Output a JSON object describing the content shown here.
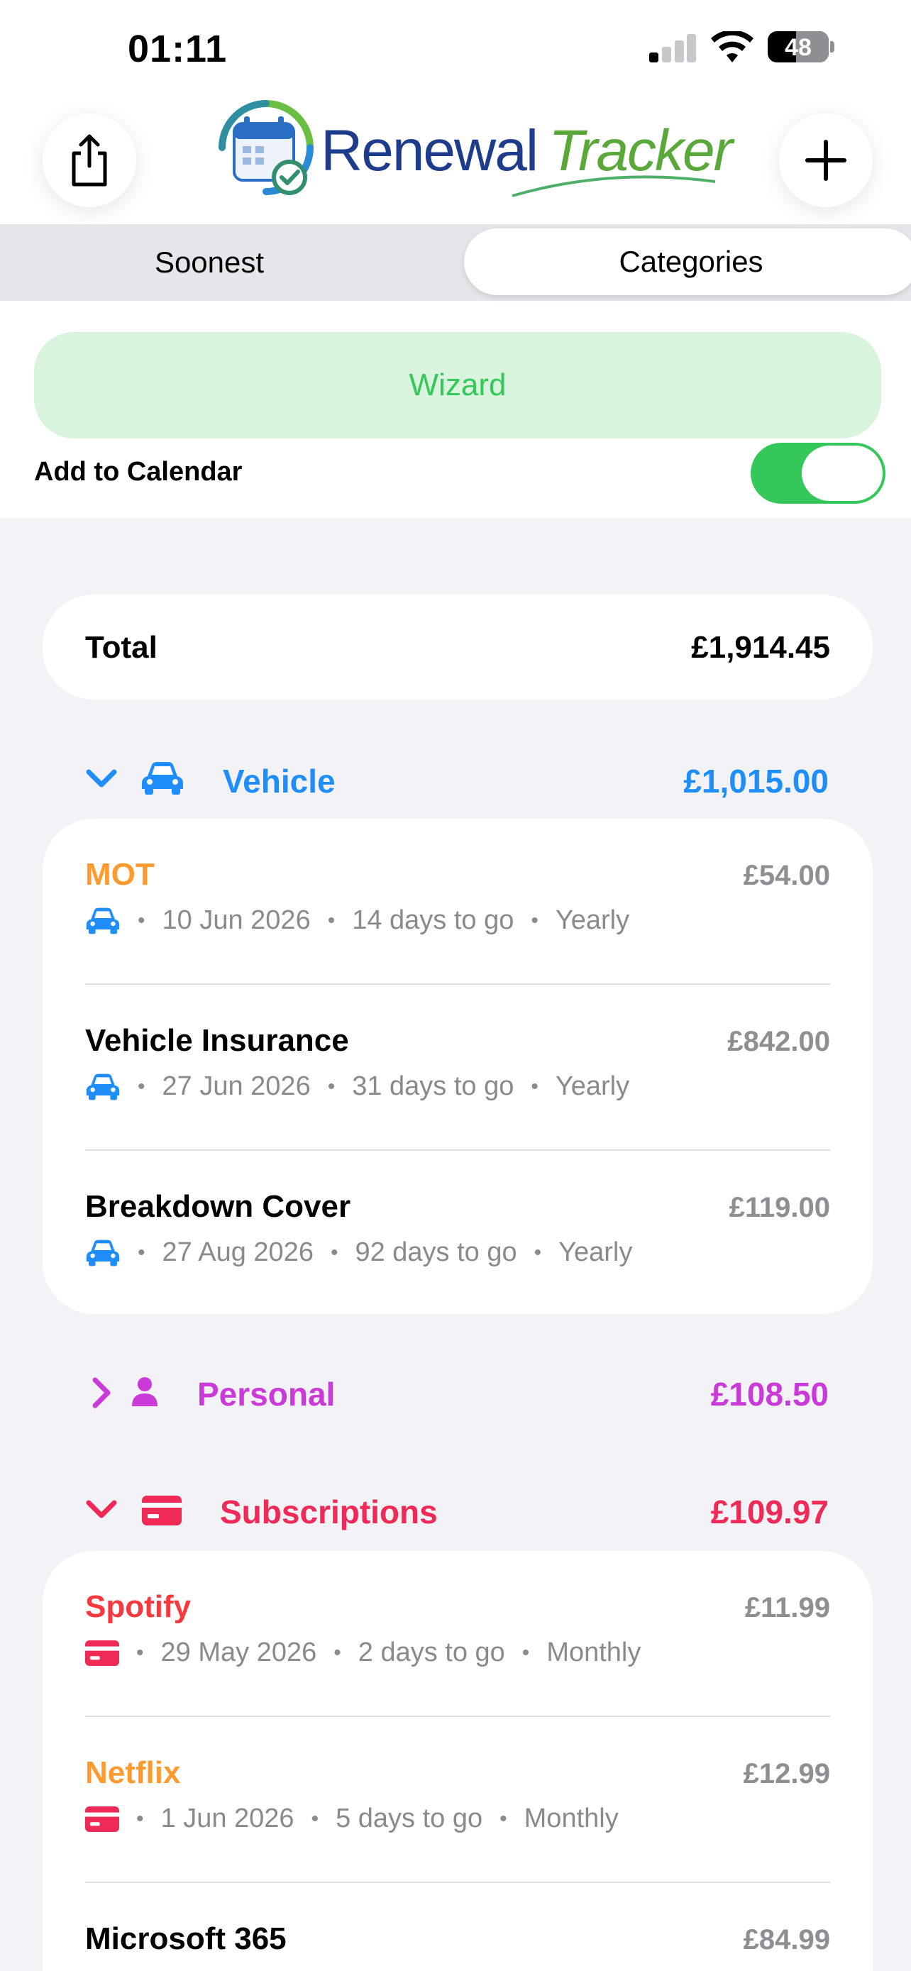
{
  "status_bar": {
    "time": "01:11",
    "battery": "48"
  },
  "header": {
    "logo_word1": "Renewal",
    "logo_word2": "Tracker"
  },
  "tabs": [
    {
      "label": "Soonest",
      "selected": false
    },
    {
      "label": "Categories",
      "selected": true
    }
  ],
  "wizard_label": "Wizard",
  "calendar": {
    "label": "Add to Calendar",
    "enabled": true
  },
  "total": {
    "label": "Total",
    "value": "£1,914.45"
  },
  "categories": [
    {
      "name": "Vehicle",
      "total": "£1,015.00",
      "color": "#1f8efa",
      "expanded": true,
      "icon": "car-icon",
      "items": [
        {
          "name": "MOT",
          "price": "£54.00",
          "date": "10 Jun 2026",
          "due": "14 days to go",
          "freq": "Yearly",
          "name_color": "#ff9a2e"
        },
        {
          "name": "Vehicle Insurance",
          "price": "£842.00",
          "date": "27 Jun 2026",
          "due": "31 days to go",
          "freq": "Yearly",
          "name_color": "#000000"
        },
        {
          "name": "Breakdown Cover",
          "price": "£119.00",
          "date": "27 Aug 2026",
          "due": "92 days to go",
          "freq": "Yearly",
          "name_color": "#000000"
        }
      ]
    },
    {
      "name": "Personal",
      "total": "£108.50",
      "color": "#c93ad8",
      "expanded": false,
      "icon": "person-icon",
      "items": []
    },
    {
      "name": "Subscriptions",
      "total": "£109.97",
      "color": "#ef2a57",
      "expanded": true,
      "icon": "card-icon",
      "items": [
        {
          "name": "Spotify",
          "price": "£11.99",
          "date": "29 May 2026",
          "due": "2 days to go",
          "freq": "Monthly",
          "name_color": "#f7383e"
        },
        {
          "name": "Netflix",
          "price": "£12.99",
          "date": "1 Jun 2026",
          "due": "5 days to go",
          "freq": "Monthly",
          "name_color": "#ff9a2e"
        },
        {
          "name": "Microsoft 365",
          "price": "£84.99",
          "name_color": "#000000"
        }
      ]
    }
  ]
}
